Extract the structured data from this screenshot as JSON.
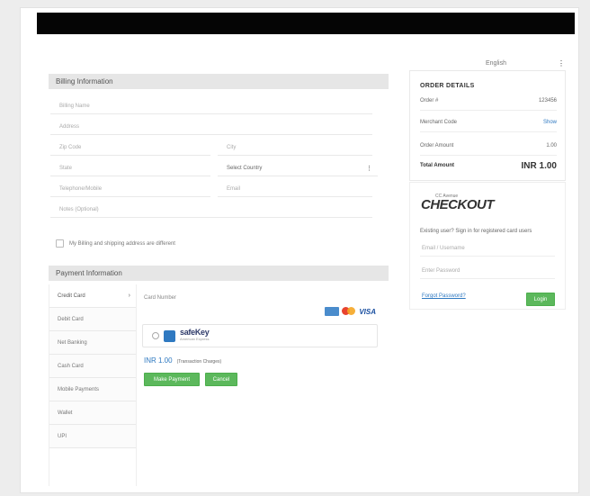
{
  "language": {
    "selected": "English"
  },
  "billing": {
    "title": "Billing Information",
    "fields": {
      "name": "Billing Name",
      "address": "Address",
      "zip": "Zip Code",
      "city": "City",
      "state": "State",
      "country": "Select Country",
      "telephone": "Telephone/Mobile",
      "email": "Email",
      "gst": "Notes (Optional)"
    },
    "shipping_checkbox": "My Billing and shipping address are different"
  },
  "payment": {
    "title": "Payment Information",
    "tabs": [
      "Credit Card",
      "Debit Card",
      "Net Banking",
      "Cash Card",
      "Mobile Payments",
      "Wallet",
      "UPI"
    ],
    "card_number_label": "Card Number",
    "logos": {
      "visa": "VISA"
    },
    "safe_brand": "safeKey",
    "safe_sub": "American Express",
    "amount": "INR 1.00",
    "amount_note": "(Transaction Charges)",
    "make_payment": "Make Payment",
    "cancel": "Cancel"
  },
  "order": {
    "title": "ORDER DETAILS",
    "rows": [
      {
        "label": "Order #",
        "value": "123456"
      },
      {
        "label": "Merchant Code",
        "value": "Show"
      },
      {
        "label": "Order Amount",
        "value": "1.00"
      },
      {
        "label": "Total Amount",
        "value": "INR 1.00"
      }
    ]
  },
  "login": {
    "brand_pre": "CC Avenue",
    "brand_name": "CHECKOUT",
    "text": "Existing user? Sign in for registered card users",
    "email_placeholder": "Email / Username",
    "password_placeholder": "Enter Password",
    "forgot": "Forgot Password?",
    "login_button": "Login"
  }
}
